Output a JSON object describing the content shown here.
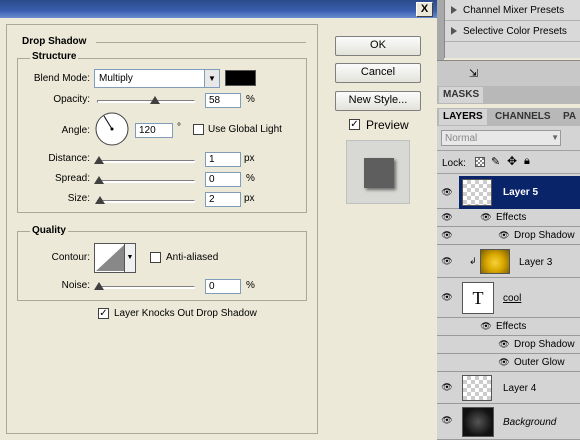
{
  "dialog": {
    "close_label": "X",
    "section_title": "Drop Shadow",
    "structure": {
      "title": "Structure",
      "blend_mode_label": "Blend Mode:",
      "blend_mode_value": "Multiply",
      "shadow_color": "#000000",
      "opacity_label": "Opacity:",
      "opacity_value": "58",
      "opacity_unit": "%",
      "angle_label": "Angle:",
      "angle_value": "120",
      "angle_unit": "°",
      "use_global_light_label": "Use Global Light",
      "distance_label": "Distance:",
      "distance_value": "1",
      "distance_unit": "px",
      "spread_label": "Spread:",
      "spread_value": "0",
      "spread_unit": "%",
      "size_label": "Size:",
      "size_value": "2",
      "size_unit": "px"
    },
    "quality": {
      "title": "Quality",
      "contour_label": "Contour:",
      "anti_aliased_label": "Anti-aliased",
      "noise_label": "Noise:",
      "noise_value": "0",
      "noise_unit": "%"
    },
    "knockout_label": "Layer Knocks Out Drop Shadow",
    "buttons": {
      "ok": "OK",
      "cancel": "Cancel",
      "new_style": "New Style...",
      "preview": "Preview"
    }
  },
  "actions": [
    "Channel Mixer Presets",
    "Selective Color Presets"
  ],
  "panel_tabs": [
    "MASKS"
  ],
  "layers_tabs": [
    "LAYERS",
    "CHANNELS",
    "PA"
  ],
  "layers_blend": "Normal",
  "lock_label": "Lock:",
  "layers": [
    {
      "name": "Layer 5",
      "effects_label": "Effects",
      "effects": [
        "Drop Shadow"
      ]
    },
    {
      "name": "Layer 3"
    },
    {
      "name": "cool",
      "thumb_text": "T",
      "effects_label": "Effects",
      "effects": [
        "Drop Shadow",
        "Outer Glow"
      ]
    },
    {
      "name": "Layer 4"
    },
    {
      "name": "Background"
    }
  ]
}
